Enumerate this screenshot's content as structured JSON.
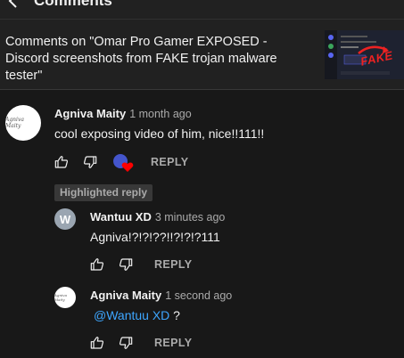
{
  "header": {
    "title": "Comments"
  },
  "video": {
    "title": "Comments on \"Omar Pro Gamer EXPOSED - Discord screenshots from FAKE trojan malware tester\"",
    "thumbnail_text": "FAKE"
  },
  "comments": [
    {
      "author": "Agniva Maity",
      "time": "1 month ago",
      "text": "cool exposing video of him, nice!!111!!",
      "avatar_text": "Agniva Maity",
      "reply_label": "REPLY"
    }
  ],
  "highlight_label": "Highlighted reply",
  "replies": [
    {
      "author": "Wantuu XD",
      "time": "3 minutes ago",
      "text": "Agniva!?!?!??!!?!?!?111",
      "avatar_initial": "W",
      "reply_label": "REPLY"
    },
    {
      "author": "Agniva Maity",
      "time": "1 second ago",
      "mention": "@Wantuu XD",
      "text_after": " ?",
      "avatar_text": "Agniva Maity",
      "reply_label": "REPLY"
    }
  ],
  "colors": {
    "background": "#181818",
    "mention": "#3ea6ff",
    "heart": "#ff0000"
  }
}
